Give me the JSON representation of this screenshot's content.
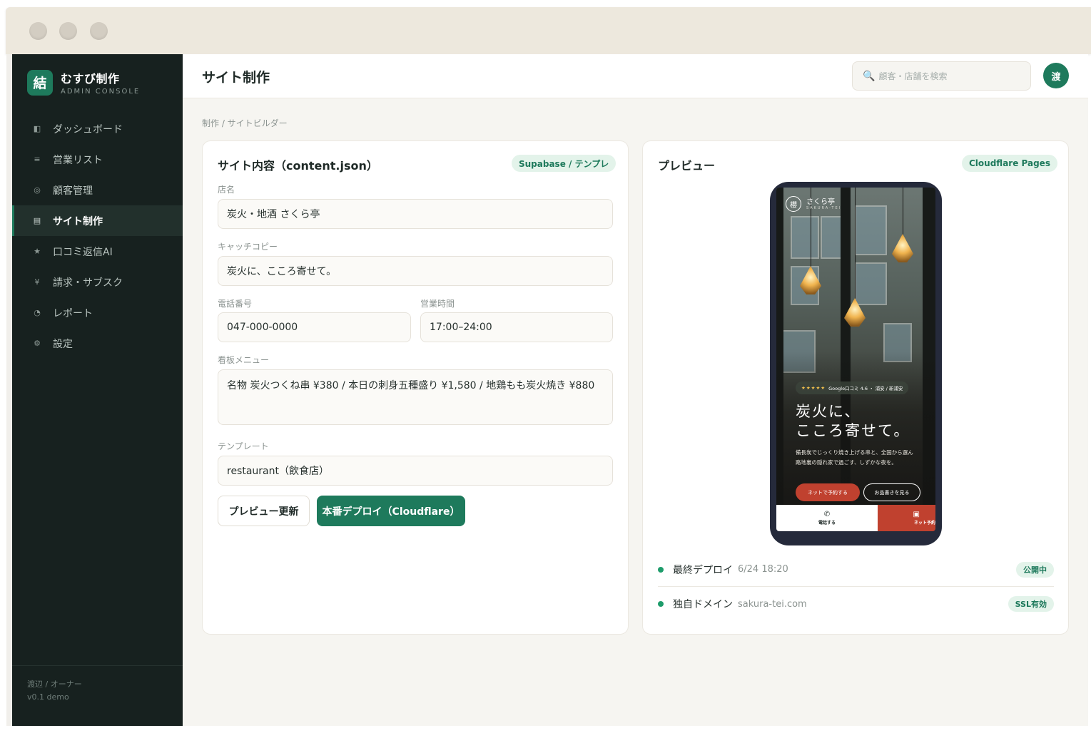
{
  "sidebar": {
    "brand_logo": "結",
    "brand_name": "むすび制作",
    "brand_sub": "ADMIN CONSOLE",
    "items": [
      {
        "icon": "◧",
        "label": "ダッシュボード"
      },
      {
        "icon": "≡",
        "label": "営業リスト"
      },
      {
        "icon": "◎",
        "label": "顧客管理"
      },
      {
        "icon": "▤",
        "label": "サイト制作"
      },
      {
        "icon": "★",
        "label": "口コミ返信AI"
      },
      {
        "icon": "¥",
        "label": "請求・サブスク"
      },
      {
        "icon": "◔",
        "label": "レポート"
      },
      {
        "icon": "⚙",
        "label": "設定"
      }
    ],
    "footer_user": "渡辺 / オーナー",
    "footer_version": "v0.1 demo"
  },
  "header": {
    "title": "サイト制作",
    "search_placeholder": "顧客・店舗を検索",
    "avatar": "渡"
  },
  "breadcrumb": "制作 / サイトビルダー",
  "editor": {
    "title": "サイト内容（content.json）",
    "badge": "Supabase / テンプレ",
    "fields": {
      "shop_name_label": "店名",
      "shop_name": "炭火・地酒 さくら亭",
      "catch_label": "キャッチコピー",
      "catch": "炭火に、こころ寄せて。",
      "phone_label": "電話番号",
      "phone": "047-000-0000",
      "hours_label": "営業時間",
      "hours": "17:00–24:00",
      "menu_label": "看板メニュー",
      "menu": "名物 炭火つくね串 ¥380 / 本日の刺身五種盛り ¥1,580 / 地鶏もも炭火焼き ¥880",
      "template_label": "テンプレート",
      "template": "restaurant（飲食店）"
    },
    "preview_button": "プレビュー更新",
    "deploy_button": "本番デプロイ（Cloudflare）"
  },
  "preview": {
    "title": "プレビュー",
    "badge": "Cloudflare Pages",
    "phone": {
      "logo": "櫻",
      "name": "さくら亭",
      "sub": "SAKURA-TEI",
      "stars": "★★★★★",
      "rating": "Google口コミ 4.6 ・ 浦安 / 新浦安",
      "headline_1": "炭火に、",
      "headline_2": "こころ寄せて。",
      "body_1": "備長炭でじっくり焼き上げる串と、全国から選ん",
      "body_2": "路地裏の隠れ家で過ごす、しずかな夜を。",
      "reserve_btn": "ネットで予約する",
      "menu_btn": "お品書きを見る",
      "call_label": "電話する",
      "reserve_label": "ネット予約"
    },
    "status": [
      {
        "label": "最終デプロイ",
        "meta": "6/24 18:20",
        "badge": "公開中"
      },
      {
        "label": "独自ドメイン",
        "meta": "sakura-tei.com",
        "badge": "SSL有効"
      }
    ]
  },
  "colors": {
    "accent": "#1e7a5c",
    "sidebar_bg": "#17211f",
    "phone_red": "#c0412f"
  }
}
